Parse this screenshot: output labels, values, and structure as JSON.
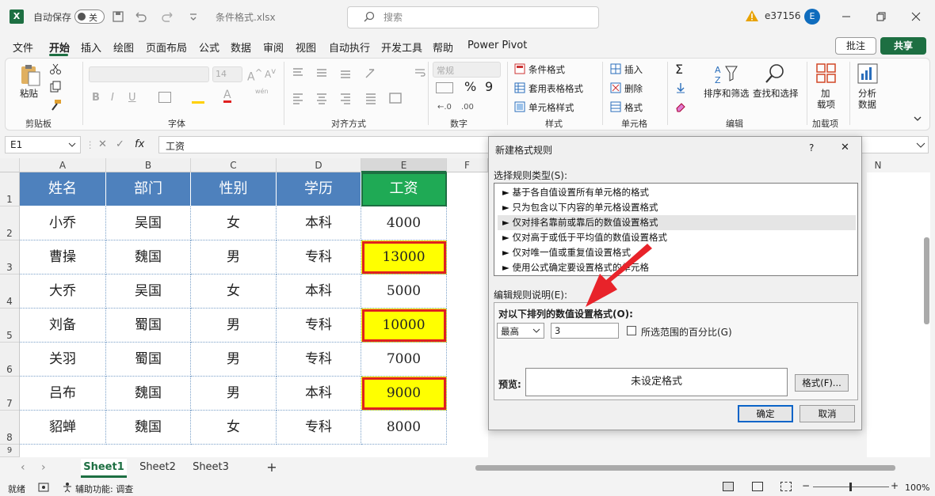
{
  "titlebar": {
    "logo": "X",
    "autosave_label": "自动保存",
    "autosave_state": "关",
    "filename": "条件格式.xlsx",
    "search_placeholder": "搜索",
    "user": "e37156",
    "avatar_letter": "E",
    "icons": [
      "save-icon",
      "undo-icon",
      "redo-icon",
      "customize-icon",
      "warning-icon",
      "minimize-icon",
      "restore-icon",
      "close-icon"
    ]
  },
  "menu": {
    "items": [
      "文件",
      "开始",
      "插入",
      "绘图",
      "页面布局",
      "公式",
      "数据",
      "审阅",
      "视图",
      "自动执行",
      "开发工具",
      "帮助",
      "Power Pivot"
    ],
    "active": "开始",
    "comment": "批注",
    "share": "共享"
  },
  "ribbon": {
    "clipboard": {
      "paste": "粘贴",
      "group": "剪贴板"
    },
    "font": {
      "size": "14",
      "group": "字体",
      "phonetic": "wén"
    },
    "alignment": {
      "group": "对齐方式"
    },
    "number": {
      "format": "常规",
      "group": "数字",
      "percent": "%",
      "comma": "9"
    },
    "styles": {
      "cond": "条件格式",
      "table": "套用表格格式",
      "cell": "单元格样式",
      "group": "样式"
    },
    "cells": {
      "insert": "插入",
      "delete": "删除",
      "format": "格式",
      "group": "单元格"
    },
    "editing": {
      "sort": "排序和筛选",
      "find": "查找和选择",
      "group": "编辑"
    },
    "addins": {
      "label1": "加",
      "label2": "载项",
      "group": "加载项"
    },
    "analysis": {
      "label1": "分析",
      "label2": "数据"
    }
  },
  "formula_bar": {
    "name_box": "E1",
    "fx": "fx",
    "content": "工资"
  },
  "grid": {
    "columns": [
      "A",
      "B",
      "C",
      "D",
      "E",
      "F",
      "N"
    ],
    "header_row": [
      "姓名",
      "部门",
      "性别",
      "学历",
      "工资"
    ],
    "rows": [
      [
        "小乔",
        "吴国",
        "女",
        "本科",
        "4000"
      ],
      [
        "曹操",
        "魏国",
        "男",
        "专科",
        "13000"
      ],
      [
        "大乔",
        "吴国",
        "女",
        "本科",
        "5000"
      ],
      [
        "刘备",
        "蜀国",
        "男",
        "专科",
        "10000"
      ],
      [
        "关羽",
        "蜀国",
        "男",
        "专科",
        "7000"
      ],
      [
        "吕布",
        "魏国",
        "男",
        "本科",
        "9000"
      ],
      [
        "貂蝉",
        "魏国",
        "女",
        "专科",
        "8000"
      ]
    ],
    "row_numbers": [
      "1",
      "2",
      "3",
      "4",
      "5",
      "6",
      "7",
      "8",
      "9"
    ],
    "highlight_color": "#ffff00",
    "highlight_border": "#e02020",
    "header_color": "#4e81bd",
    "selected_header_color": "#1faa55"
  },
  "sheets": {
    "tabs": [
      "Sheet1",
      "Sheet2",
      "Sheet3"
    ],
    "active": "Sheet1",
    "add": "+"
  },
  "status": {
    "ready": "就绪",
    "accessibility": "辅助功能: 调查",
    "zoom": "100%"
  },
  "dialog": {
    "title": "新建格式规则",
    "help": "?",
    "close": "✕",
    "select_type_label": "选择规则类型(S):",
    "rule_types": [
      "基于各自值设置所有单元格的格式",
      "只为包含以下内容的单元格设置格式",
      "仅对排名靠前或靠后的数值设置格式",
      "仅对高于或低于平均值的数值设置格式",
      "仅对唯一值或重复值设置格式",
      "使用公式确定要设置格式的单元格"
    ],
    "selected_rule": 2,
    "edit_label": "编辑规则说明(E):",
    "format_label": "对以下排列的数值设置格式(O):",
    "rank_select": "最高",
    "rank_value": "3",
    "percent_label": "所选范围的百分比(G)",
    "preview_label": "预览:",
    "preview_text": "未设定格式",
    "format_button": "格式(F)...",
    "ok": "确定",
    "cancel": "取消",
    "arrow_color": "#e8232a"
  }
}
